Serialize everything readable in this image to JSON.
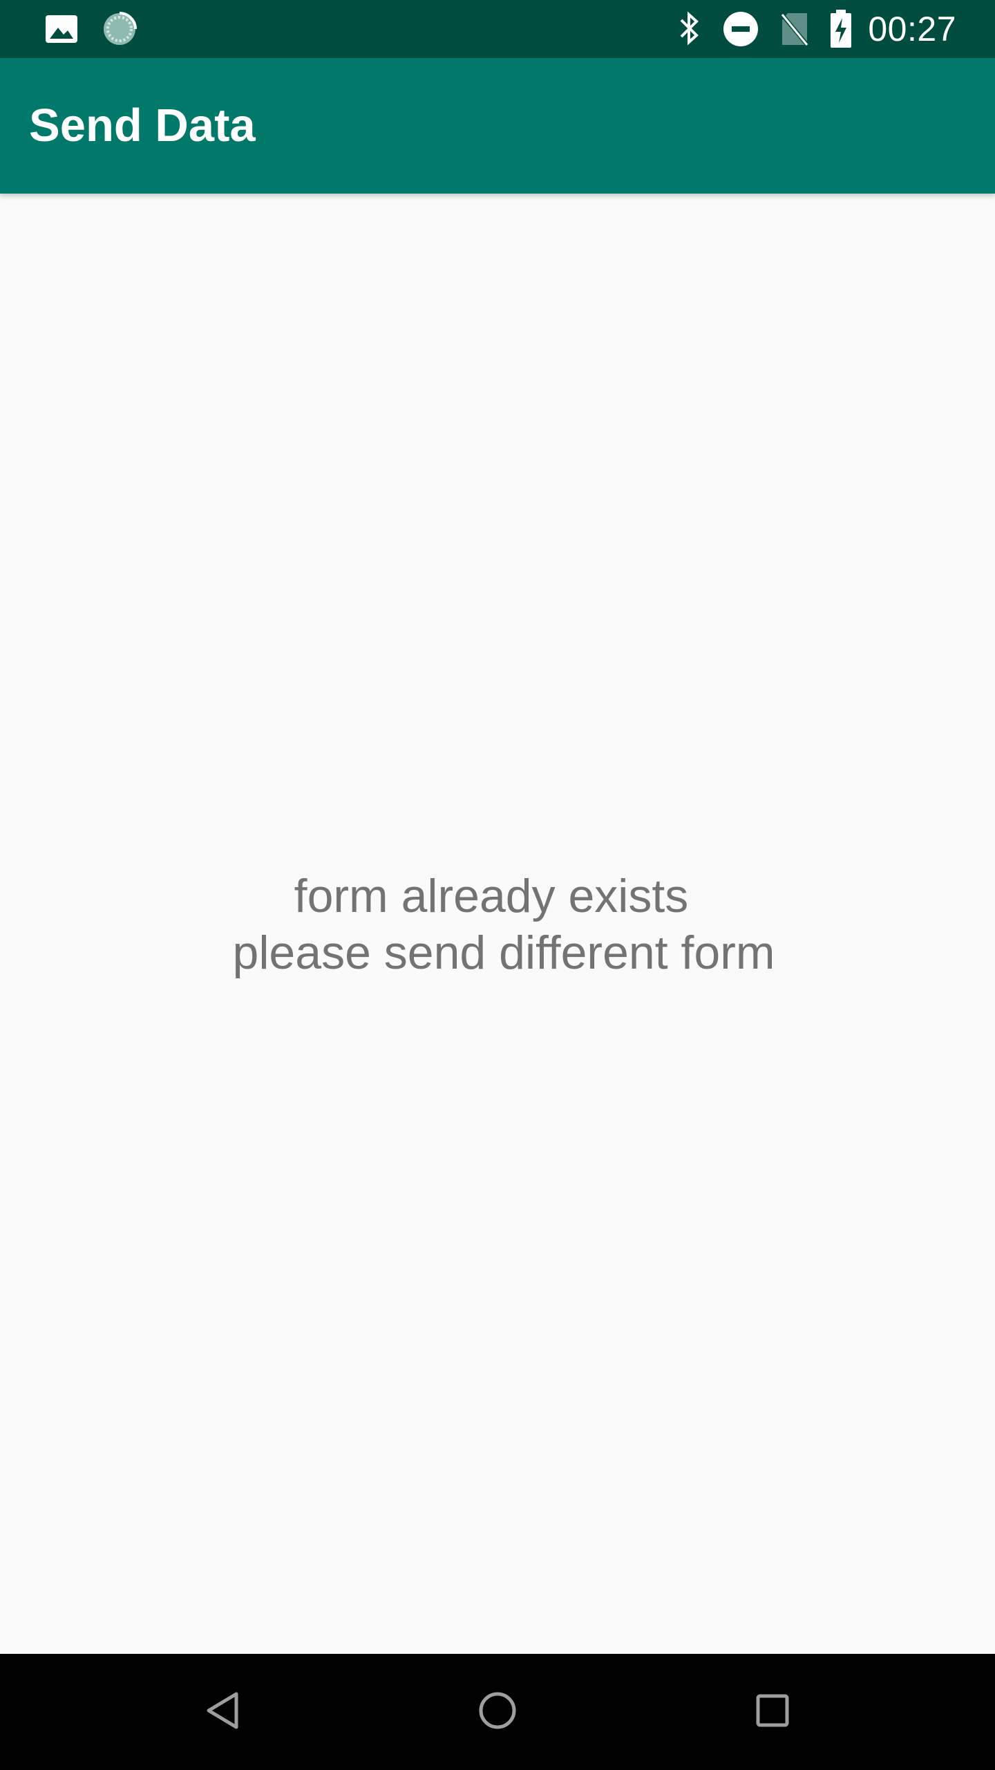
{
  "status_bar": {
    "time": "00:27",
    "left_icons": [
      "image-notification-icon",
      "sync-progress-icon"
    ],
    "right_icons": [
      "bluetooth-icon",
      "do-not-disturb-icon",
      "no-sim-icon",
      "battery-charging-icon"
    ],
    "background_color": "#004d40"
  },
  "app_bar": {
    "title": "Send Data",
    "background_color": "#00796b"
  },
  "main": {
    "message_line1": "form already exists",
    "message_line2": "please send different form",
    "text_color": "#737373",
    "background_color": "#fafafa"
  },
  "nav_bar": {
    "buttons": [
      "back-icon",
      "home-icon",
      "recents-icon"
    ],
    "background_color": "#000000"
  }
}
